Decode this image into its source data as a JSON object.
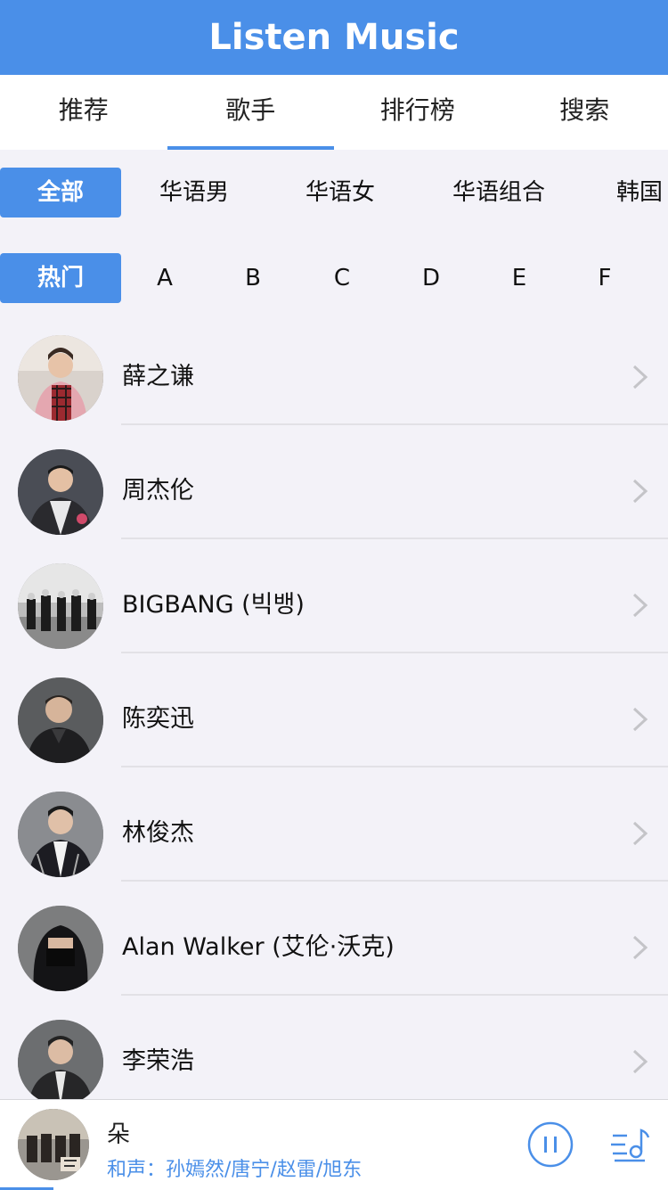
{
  "header": {
    "title": "Listen Music"
  },
  "tabs": [
    {
      "label": "推荐"
    },
    {
      "label": "歌手"
    },
    {
      "label": "排行榜"
    },
    {
      "label": "搜索"
    }
  ],
  "categories": [
    "全部",
    "华语男",
    "华语女",
    "华语组合",
    "韩国"
  ],
  "letters": [
    "热门",
    "A",
    "B",
    "C",
    "D",
    "E",
    "F"
  ],
  "singers": [
    {
      "name": "薛之谦"
    },
    {
      "name": "周杰伦"
    },
    {
      "name": "BIGBANG (빅뱅)"
    },
    {
      "name": "陈奕迅"
    },
    {
      "name": "林俊杰"
    },
    {
      "name": "Alan Walker (艾伦·沃克)"
    },
    {
      "name": "李荣浩"
    }
  ],
  "player": {
    "title": "朵",
    "artist": "和声：孙嫣然/唐宁/赵雷/旭东"
  },
  "colors": {
    "accent": "#4a8fe8",
    "background": "#f3f2f8"
  }
}
